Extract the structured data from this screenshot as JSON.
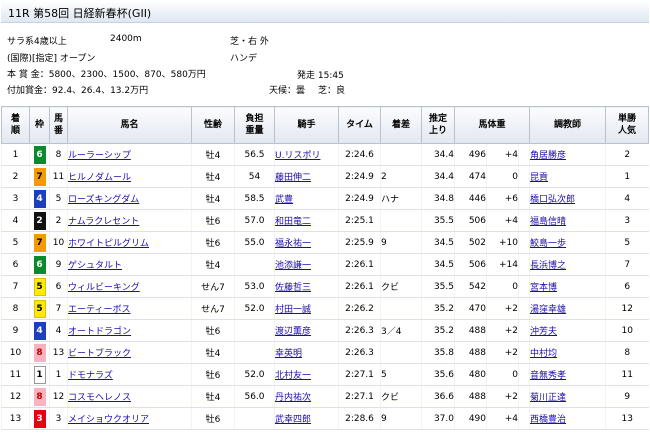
{
  "race": {
    "title": "11R 第58回 日経新春杯(GII)",
    "class": "サラ系4歳以上",
    "distance": "2400m",
    "course": "芝・右 外",
    "condition": "(国際)[指定] オープン",
    "weight_rule": "ハンデ",
    "prize": "本 賞 金：5800、2300、1500、870、580万円",
    "start_time": "発走 15:45",
    "added_prize": "付加賞金：92.4、26.4、13.2万円",
    "weather": "天候：曇",
    "track": "芝：良"
  },
  "columns": {
    "finish": [
      "着",
      "順"
    ],
    "waku": "枠",
    "umaban": [
      "馬",
      "番"
    ],
    "horse": "馬名",
    "sex_age": "性齢",
    "weight": [
      "負担",
      "重量"
    ],
    "jockey": "騎手",
    "time": "タイム",
    "margin": "着差",
    "last3f": [
      "推定",
      "上り"
    ],
    "body_weight": "馬体重",
    "trainer": "調教師",
    "popularity": [
      "単勝",
      "人気"
    ]
  },
  "waku_colors": {
    "1": {
      "bg": "#ffffff",
      "fg": "#000000",
      "border": "#999999"
    },
    "2": {
      "bg": "#111111",
      "fg": "#ffffff",
      "border": "#111111"
    },
    "3": {
      "bg": "#e60012",
      "fg": "#ffffff",
      "border": "#e60012"
    },
    "4": {
      "bg": "#1c3fbf",
      "fg": "#ffffff",
      "border": "#1c3fbf"
    },
    "5": {
      "bg": "#ffeb00",
      "fg": "#000000",
      "border": "#d6c500"
    },
    "6": {
      "bg": "#0a8a2a",
      "fg": "#ffffff",
      "border": "#0a8a2a"
    },
    "7": {
      "bg": "#f59a00",
      "fg": "#000000",
      "border": "#f59a00"
    },
    "8": {
      "bg": "#f7b3c0",
      "fg": "#c00000",
      "border": "#f7b3c0"
    }
  },
  "rows": [
    {
      "finish": "1",
      "waku": "6",
      "umaban": "8",
      "horse": "ルーラーシップ",
      "sex_age": "牡4",
      "weight": "56.5",
      "jockey": "U.リスポリ",
      "time": "2:24.6",
      "margin": "",
      "last3f": "34.4",
      "body_weight": "496",
      "diff": "+4",
      "trainer": "角居勝彦",
      "popularity": "2"
    },
    {
      "finish": "2",
      "waku": "7",
      "umaban": "11",
      "horse": "ヒルノダムール",
      "sex_age": "牡4",
      "weight": "54",
      "jockey": "藤田伸二",
      "time": "2:24.9",
      "margin": "2",
      "last3f": "34.4",
      "body_weight": "474",
      "diff": "0",
      "trainer": "昆貢",
      "popularity": "1"
    },
    {
      "finish": "3",
      "waku": "4",
      "umaban": "5",
      "horse": "ローズキングダム",
      "sex_age": "牡4",
      "weight": "58.5",
      "jockey": "武豊",
      "time": "2:24.9",
      "margin": "ハナ",
      "last3f": "34.8",
      "body_weight": "446",
      "diff": "+6",
      "trainer": "橋口弘次郎",
      "popularity": "4"
    },
    {
      "finish": "4",
      "waku": "2",
      "umaban": "2",
      "horse": "ナムラクレセント",
      "sex_age": "牡6",
      "weight": "57.0",
      "jockey": "和田竜二",
      "time": "2:25.1",
      "margin": "",
      "last3f": "35.5",
      "body_weight": "506",
      "diff": "+4",
      "trainer": "福島信晴",
      "popularity": "3"
    },
    {
      "finish": "5",
      "waku": "7",
      "umaban": "10",
      "horse": "ホワイトピルグリム",
      "sex_age": "牡6",
      "weight": "55.0",
      "jockey": "福永祐一",
      "time": "2:25.9",
      "margin": "9",
      "last3f": "34.5",
      "body_weight": "502",
      "diff": "+10",
      "trainer": "鮫島一歩",
      "popularity": "5"
    },
    {
      "finish": "6",
      "waku": "6",
      "umaban": "9",
      "horse": "ゲシュタルト",
      "sex_age": "牡4",
      "weight": "",
      "jockey": "池添謙一",
      "time": "2:26.1",
      "margin": "",
      "last3f": "34.5",
      "body_weight": "506",
      "diff": "+14",
      "trainer": "長浜博之",
      "popularity": "7"
    },
    {
      "finish": "7",
      "waku": "5",
      "umaban": "6",
      "horse": "ウィルビーキング",
      "sex_age": "せん7",
      "weight": "53.0",
      "jockey": "佐藤哲三",
      "time": "2:26.1",
      "margin": "クビ",
      "last3f": "35.5",
      "body_weight": "542",
      "diff": "0",
      "trainer": "宮本博",
      "popularity": "6"
    },
    {
      "finish": "8",
      "waku": "5",
      "umaban": "7",
      "horse": "エーティーボス",
      "sex_age": "せん7",
      "weight": "52.0",
      "jockey": "村田一誠",
      "time": "2:26.2",
      "margin": "",
      "last3f": "35.2",
      "body_weight": "470",
      "diff": "+2",
      "trainer": "湯窪幸雄",
      "popularity": "12"
    },
    {
      "finish": "9",
      "waku": "4",
      "umaban": "4",
      "horse": "オートドラゴン",
      "sex_age": "牡6",
      "weight": "",
      "jockey": "渡辺薫彦",
      "time": "2:26.3",
      "margin": "3／4",
      "last3f": "35.2",
      "body_weight": "488",
      "diff": "+2",
      "trainer": "沖芳夫",
      "popularity": "10"
    },
    {
      "finish": "10",
      "waku": "8",
      "umaban": "13",
      "horse": "ビートブラック",
      "sex_age": "牡4",
      "weight": "",
      "jockey": "幸英明",
      "time": "2:26.3",
      "margin": "",
      "last3f": "35.8",
      "body_weight": "488",
      "diff": "+2",
      "trainer": "中村均",
      "popularity": "8"
    },
    {
      "finish": "11",
      "waku": "1",
      "umaban": "1",
      "horse": "ドモナラズ",
      "sex_age": "牡6",
      "weight": "52.0",
      "jockey": "北村友一",
      "time": "2:27.1",
      "margin": "5",
      "last3f": "35.6",
      "body_weight": "480",
      "diff": "0",
      "trainer": "音無秀孝",
      "popularity": "11"
    },
    {
      "finish": "12",
      "waku": "8",
      "umaban": "12",
      "horse": "コスモヘレノス",
      "sex_age": "牡4",
      "weight": "56.0",
      "jockey": "丹内祐次",
      "time": "2:27.1",
      "margin": "クビ",
      "last3f": "36.6",
      "body_weight": "488",
      "diff": "+2",
      "trainer": "菊川正達",
      "popularity": "9"
    },
    {
      "finish": "13",
      "waku": "3",
      "umaban": "3",
      "horse": "メイショウクオリア",
      "sex_age": "牡6",
      "weight": "",
      "jockey": "武幸四郎",
      "time": "2:28.6",
      "margin": "9",
      "last3f": "37.0",
      "body_weight": "490",
      "diff": "+4",
      "trainer": "西橋豊治",
      "popularity": "13"
    }
  ]
}
